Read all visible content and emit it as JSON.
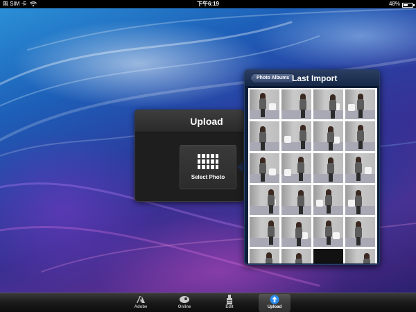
{
  "status_bar": {
    "carrier": "無 SIM 卡",
    "time": "下午6:19",
    "battery": "48%",
    "battery_level": 0.48
  },
  "upload_panel": {
    "title": "Upload",
    "select_photo_label": "Select Photo"
  },
  "albums_panel": {
    "back_label": "Photo Albums",
    "title": "Last Import",
    "thumbnail_count": 24
  },
  "tab_bar": {
    "tabs": [
      {
        "label": "Adobe",
        "icon": "adobe-icon",
        "active": false
      },
      {
        "label": "Online",
        "icon": "online-icon",
        "active": false
      },
      {
        "label": "Edit",
        "icon": "edit-icon",
        "active": false
      },
      {
        "label": "Upload",
        "icon": "upload-icon",
        "active": true
      }
    ]
  }
}
